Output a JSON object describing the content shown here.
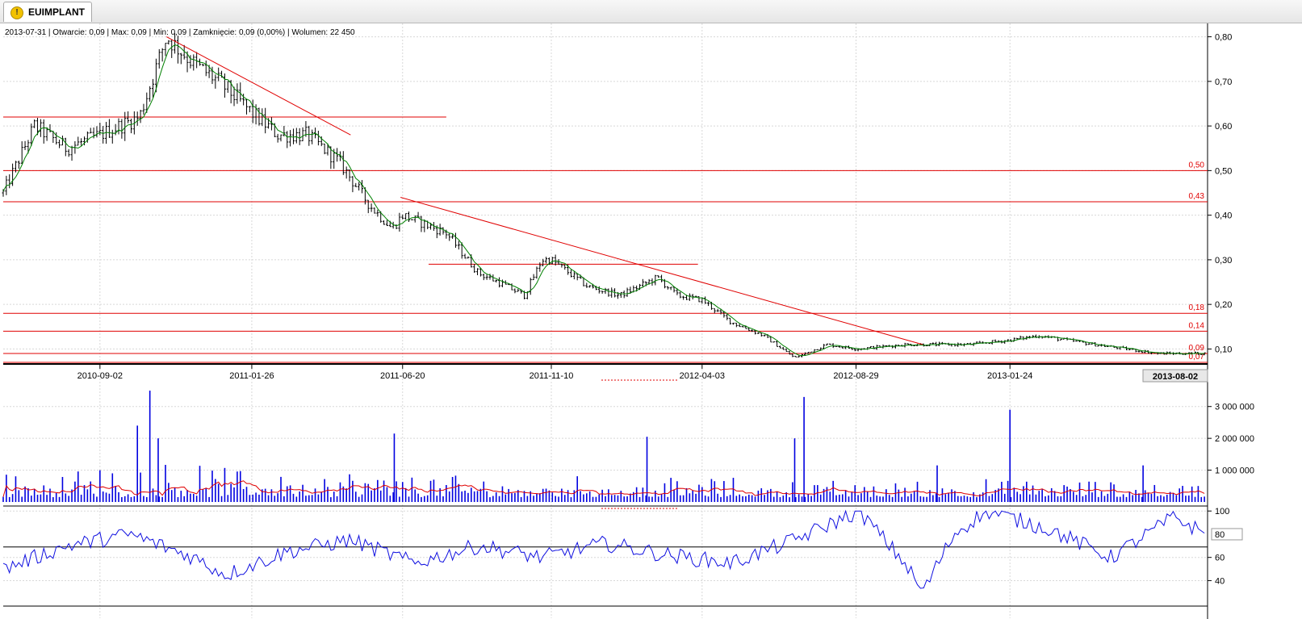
{
  "tab": {
    "label": "EUIMPLANT",
    "icon": "warning-icon"
  },
  "info_line": "2013-07-31 | Otwarcie: 0,09 | Max: 0,09 | Min: 0,09 | Zamknięcie: 0,09 (0,00%)   | Wolumen: 22 450",
  "chart_data": [
    {
      "type": "candlestick",
      "x_ticks": [
        "2010-09-02",
        "2011-01-26",
        "2011-06-20",
        "2011-11-10",
        "2012-04-03",
        "2012-08-29",
        "2013-01-24"
      ],
      "cursor_date": "2013-08-02",
      "y_ticks": [
        "0,80",
        "0,70",
        "0,60",
        "0,50",
        "0,40",
        "0,30",
        "0,20",
        "0,10"
      ],
      "ylim": [
        0.07,
        0.83
      ],
      "grid": true,
      "price_path": [
        [
          "2010-06-01",
          0.45
        ],
        [
          "2010-07-01",
          0.6
        ],
        [
          "2010-08-01",
          0.55
        ],
        [
          "2010-09-02",
          0.58
        ],
        [
          "2010-10-10",
          0.62
        ],
        [
          "2010-11-05",
          0.8
        ],
        [
          "2010-12-01",
          0.74
        ],
        [
          "2010-12-25",
          0.7
        ],
        [
          "2011-01-26",
          0.63
        ],
        [
          "2011-02-20",
          0.58
        ],
        [
          "2011-03-20",
          0.58
        ],
        [
          "2011-04-20",
          0.52
        ],
        [
          "2011-05-20",
          0.42
        ],
        [
          "2011-06-10",
          0.37
        ],
        [
          "2011-06-20",
          0.4
        ],
        [
          "2011-08-01",
          0.36
        ],
        [
          "2011-09-01",
          0.27
        ],
        [
          "2011-09-20",
          0.25
        ],
        [
          "2011-10-15",
          0.22
        ],
        [
          "2011-11-01",
          0.3
        ],
        [
          "2011-11-10",
          0.3
        ],
        [
          "2011-12-15",
          0.24
        ],
        [
          "2012-01-15",
          0.22
        ],
        [
          "2012-02-20",
          0.26
        ],
        [
          "2012-03-10",
          0.22
        ],
        [
          "2012-04-03",
          0.21
        ],
        [
          "2012-05-01",
          0.16
        ],
        [
          "2012-06-01",
          0.13
        ],
        [
          "2012-07-01",
          0.08
        ],
        [
          "2012-08-01",
          0.11
        ],
        [
          "2012-08-29",
          0.1
        ],
        [
          "2012-10-15",
          0.11
        ],
        [
          "2012-12-15",
          0.11
        ],
        [
          "2013-01-24",
          0.12
        ],
        [
          "2013-02-20",
          0.13
        ],
        [
          "2013-04-15",
          0.11
        ],
        [
          "2013-06-15",
          0.09
        ],
        [
          "2013-07-31",
          0.09
        ]
      ],
      "horizontal_levels": [
        {
          "value": 0.62,
          "range": [
            "2010-06-01",
            "2011-08-01"
          ]
        },
        {
          "value": 0.5,
          "label": "0,50"
        },
        {
          "value": 0.43,
          "label": "0,43"
        },
        {
          "value": 0.29,
          "range": [
            "2011-07-15",
            "2012-03-30"
          ]
        },
        {
          "value": 0.18,
          "label": "0,18"
        },
        {
          "value": 0.14,
          "label": "0,14"
        },
        {
          "value": 0.09,
          "label": "0,09"
        },
        {
          "value": 0.07,
          "label": "0,07"
        }
      ],
      "trend_lines": [
        [
          [
            "2010-11-05",
            0.8
          ],
          [
            "2011-05-01",
            0.58
          ]
        ],
        [
          [
            "2011-06-18",
            0.44
          ],
          [
            "2012-11-01",
            0.11
          ]
        ]
      ]
    },
    {
      "type": "bar",
      "name": "volume",
      "y_ticks": [
        "3 000 000",
        "2 000 000",
        "1 000 000"
      ],
      "ylim": [
        0,
        3500000
      ],
      "spikes": [
        [
          "2010-10-08",
          2400000
        ],
        [
          "2010-10-20",
          3500000
        ],
        [
          "2010-10-28",
          2000000
        ],
        [
          "2011-06-12",
          2150000
        ],
        [
          "2012-02-10",
          2050000
        ],
        [
          "2012-07-10",
          3300000
        ],
        [
          "2012-07-01",
          2000000
        ],
        [
          "2012-11-15",
          1150000
        ],
        [
          "2013-01-24",
          2900000
        ],
        [
          "2013-06-01",
          1150000
        ]
      ]
    },
    {
      "type": "line",
      "name": "oscillator",
      "y_ticks": [
        "100",
        "60",
        "40"
      ],
      "ylim": [
        25,
        105
      ],
      "marked_value": "80",
      "reference_level": 69,
      "path": [
        [
          "2010-06-01",
          50
        ],
        [
          "2010-08-01",
          70
        ],
        [
          "2010-10-01",
          80
        ],
        [
          "2010-12-01",
          60
        ],
        [
          "2011-01-01",
          45
        ],
        [
          "2011-03-01",
          65
        ],
        [
          "2011-05-01",
          75
        ],
        [
          "2011-07-01",
          55
        ],
        [
          "2011-09-01",
          70
        ],
        [
          "2011-11-01",
          60
        ],
        [
          "2012-01-01",
          72
        ],
        [
          "2012-03-01",
          62
        ],
        [
          "2012-05-01",
          55
        ],
        [
          "2012-07-01",
          75
        ],
        [
          "2012-09-01",
          100
        ],
        [
          "2012-10-15",
          55
        ],
        [
          "2012-11-01",
          30
        ],
        [
          "2012-12-01",
          80
        ],
        [
          "2013-01-01",
          100
        ],
        [
          "2013-03-01",
          85
        ],
        [
          "2013-05-01",
          60
        ],
        [
          "2013-07-01",
          95
        ],
        [
          "2013-07-31",
          80
        ]
      ]
    }
  ],
  "colors": {
    "up": "#000000",
    "ma": "#008000",
    "level": "#e00000",
    "volume": "#0000e0",
    "vol_ma": "#e00000",
    "osc": "#1010e0"
  }
}
